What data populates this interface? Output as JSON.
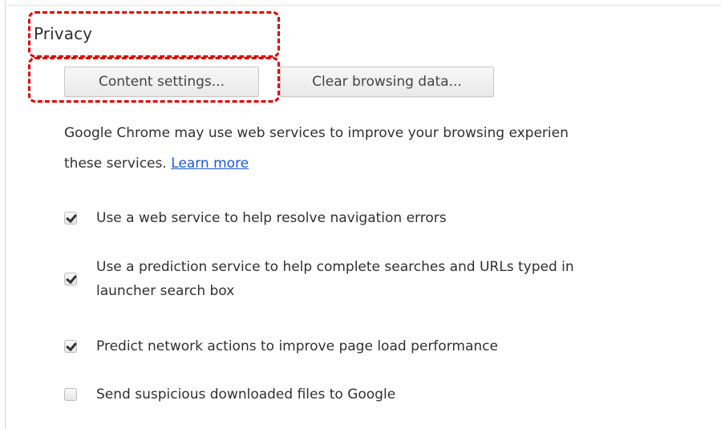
{
  "privacy": {
    "title": "Privacy",
    "buttons": {
      "content_settings": "Content settings...",
      "clear_browsing_data": "Clear browsing data..."
    },
    "description": {
      "line1": "Google Chrome may use web services to improve your browsing experien",
      "line2_prefix": "these services.",
      "learn_more": "Learn more"
    },
    "options": [
      {
        "line1": "Use a web service to help resolve navigation errors",
        "checked": true
      },
      {
        "line1": "Use a prediction service to help complete searches and URLs typed in",
        "line2": "launcher search box",
        "checked": true
      },
      {
        "line1": "Predict network actions to improve page load performance",
        "checked": true
      },
      {
        "line1": "Send suspicious downloaded files to Google",
        "checked": false
      }
    ]
  },
  "colors": {
    "link": "#1a59d6",
    "annotation": "#dd0000"
  }
}
